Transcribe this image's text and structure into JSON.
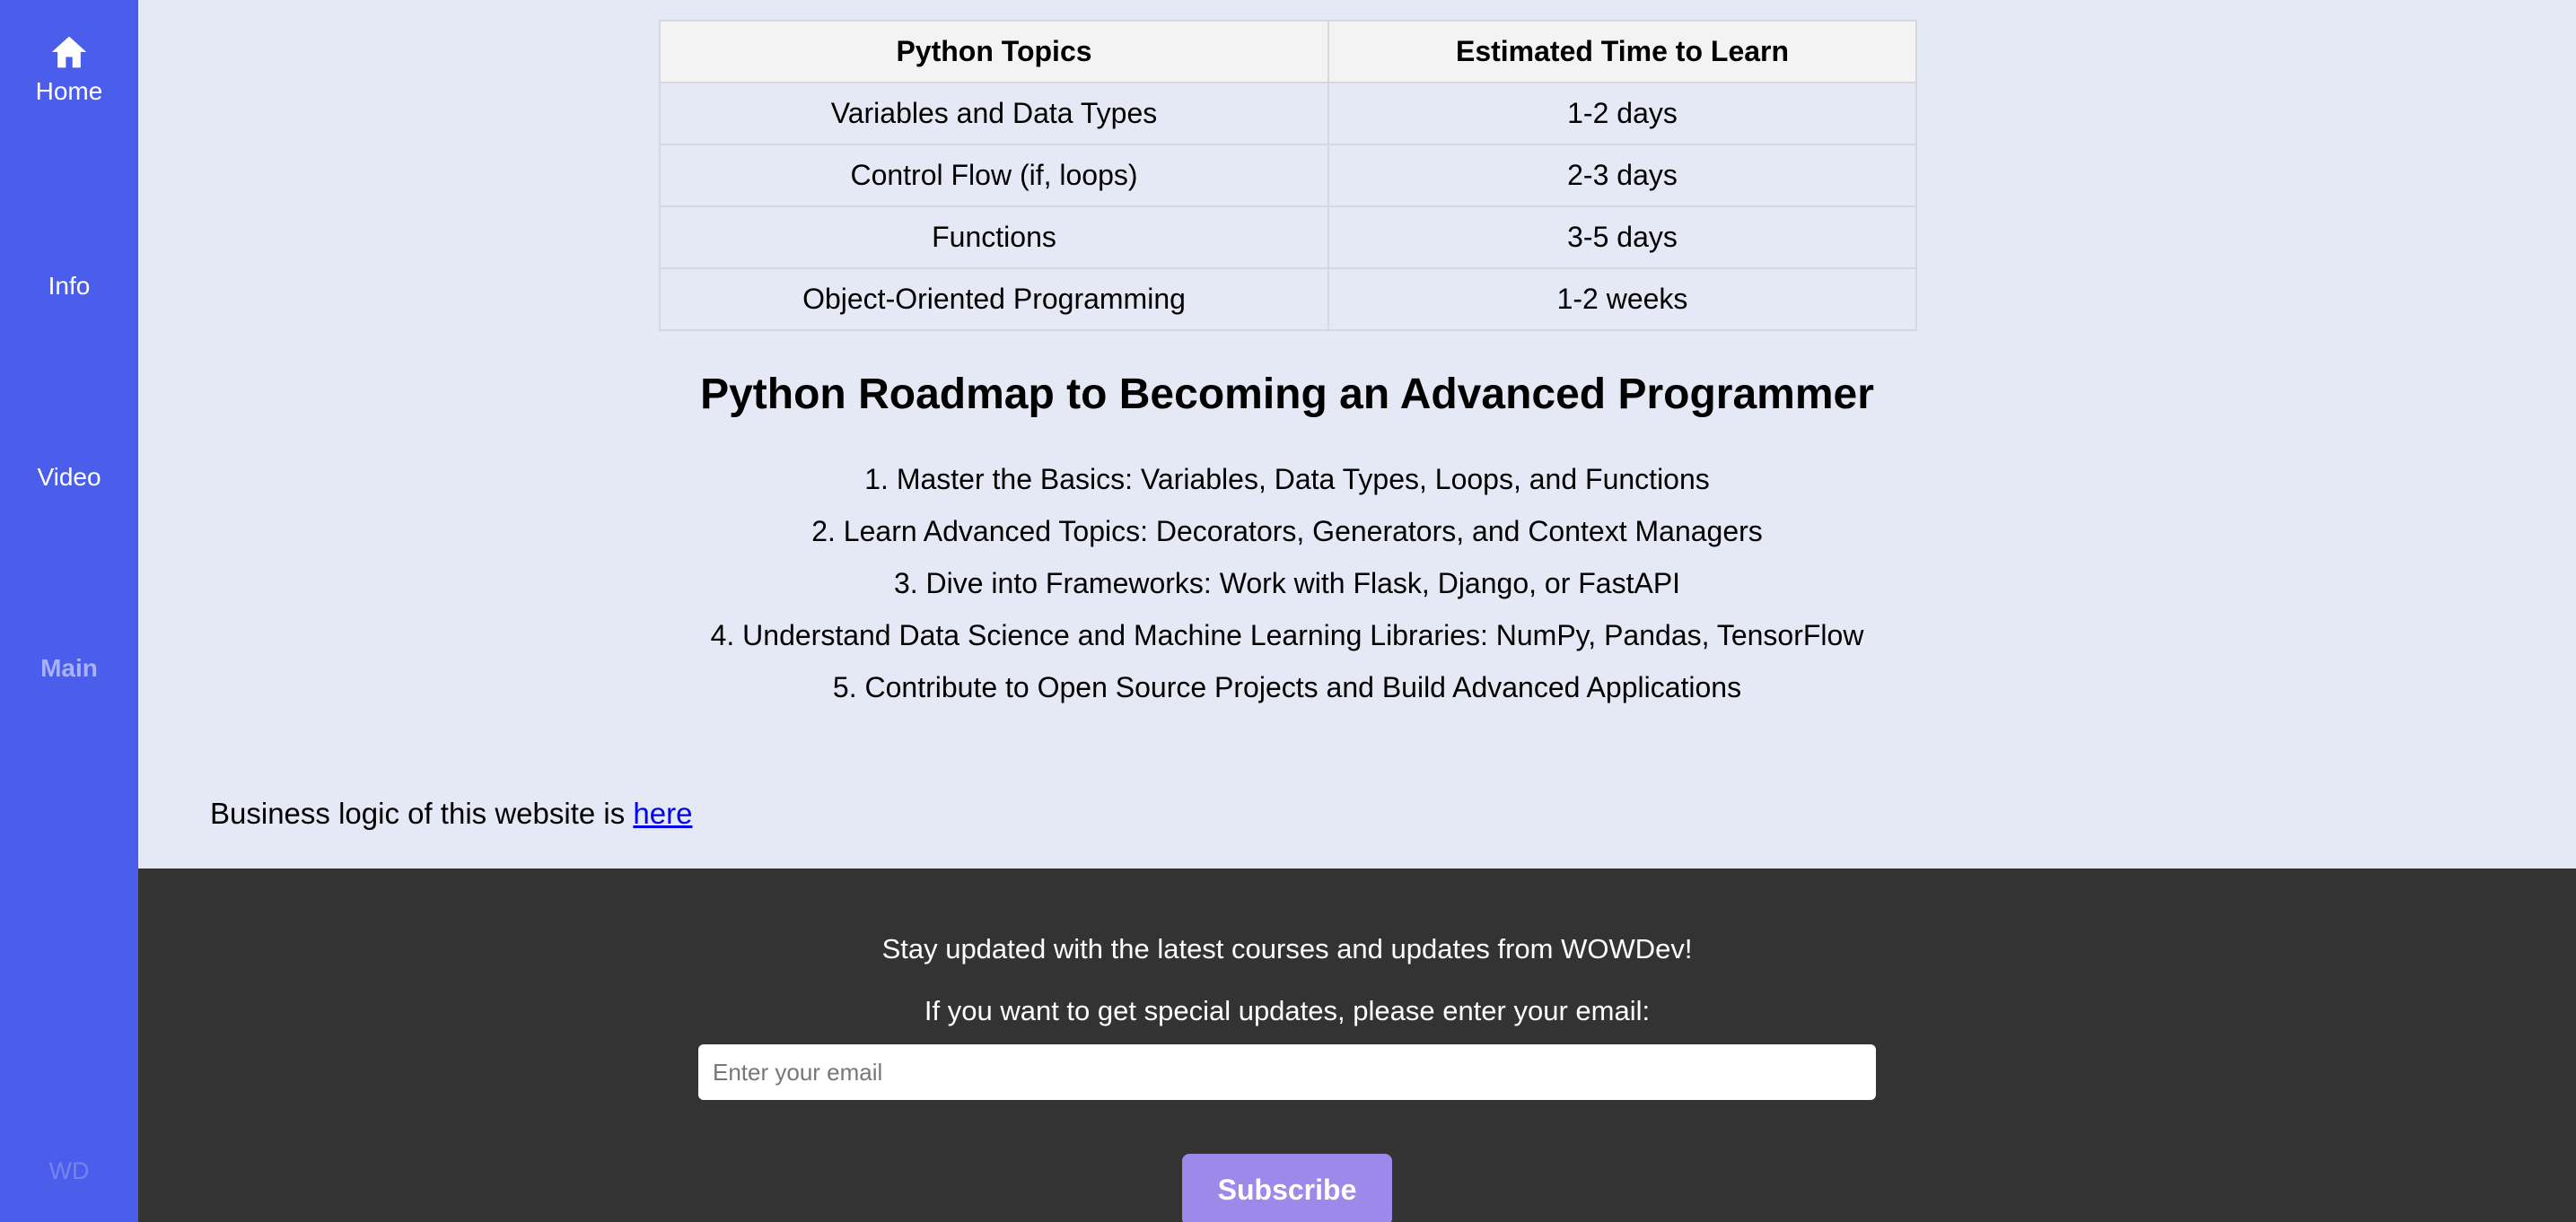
{
  "sidebar": {
    "items": [
      {
        "label": "Home",
        "icon": "home-icon"
      },
      {
        "label": "Info"
      },
      {
        "label": "Video"
      },
      {
        "label": "Main"
      }
    ],
    "brand": "WD",
    "colors": {
      "background": "#4a5deb",
      "active": "#a9b2f7"
    }
  },
  "topics_table": {
    "headers": [
      "Python Topics",
      "Estimated Time to Learn"
    ],
    "rows": [
      [
        "Variables and Data Types",
        "1-2 days"
      ],
      [
        "Control Flow (if, loops)",
        "2-3 days"
      ],
      [
        "Functions",
        "3-5 days"
      ],
      [
        "Object-Oriented Programming",
        "1-2 weeks"
      ]
    ]
  },
  "roadmap": {
    "title": "Python Roadmap to Becoming an Advanced Programmer",
    "steps": [
      "1. Master the Basics: Variables, Data Types, Loops, and Functions",
      "2. Learn Advanced Topics: Decorators, Generators, and Context Managers",
      "3. Dive into Frameworks: Work with Flask, Django, or FastAPI",
      "4. Understand Data Science and Machine Learning Libraries: NumPy, Pandas, TensorFlow",
      "5. Contribute to Open Source Projects and Build Advanced Applications"
    ]
  },
  "business": {
    "text": "Business logic of this website is ",
    "link_text": "here"
  },
  "footer": {
    "line1": "Stay updated with the latest courses and updates from WOWDev!",
    "line2": "If you want to get special updates, please enter your email:",
    "email_placeholder": "Enter your email",
    "email_value": "",
    "subscribe_label": "Subscribe",
    "colors": {
      "background": "#333333",
      "button": "#9d89ea"
    }
  }
}
